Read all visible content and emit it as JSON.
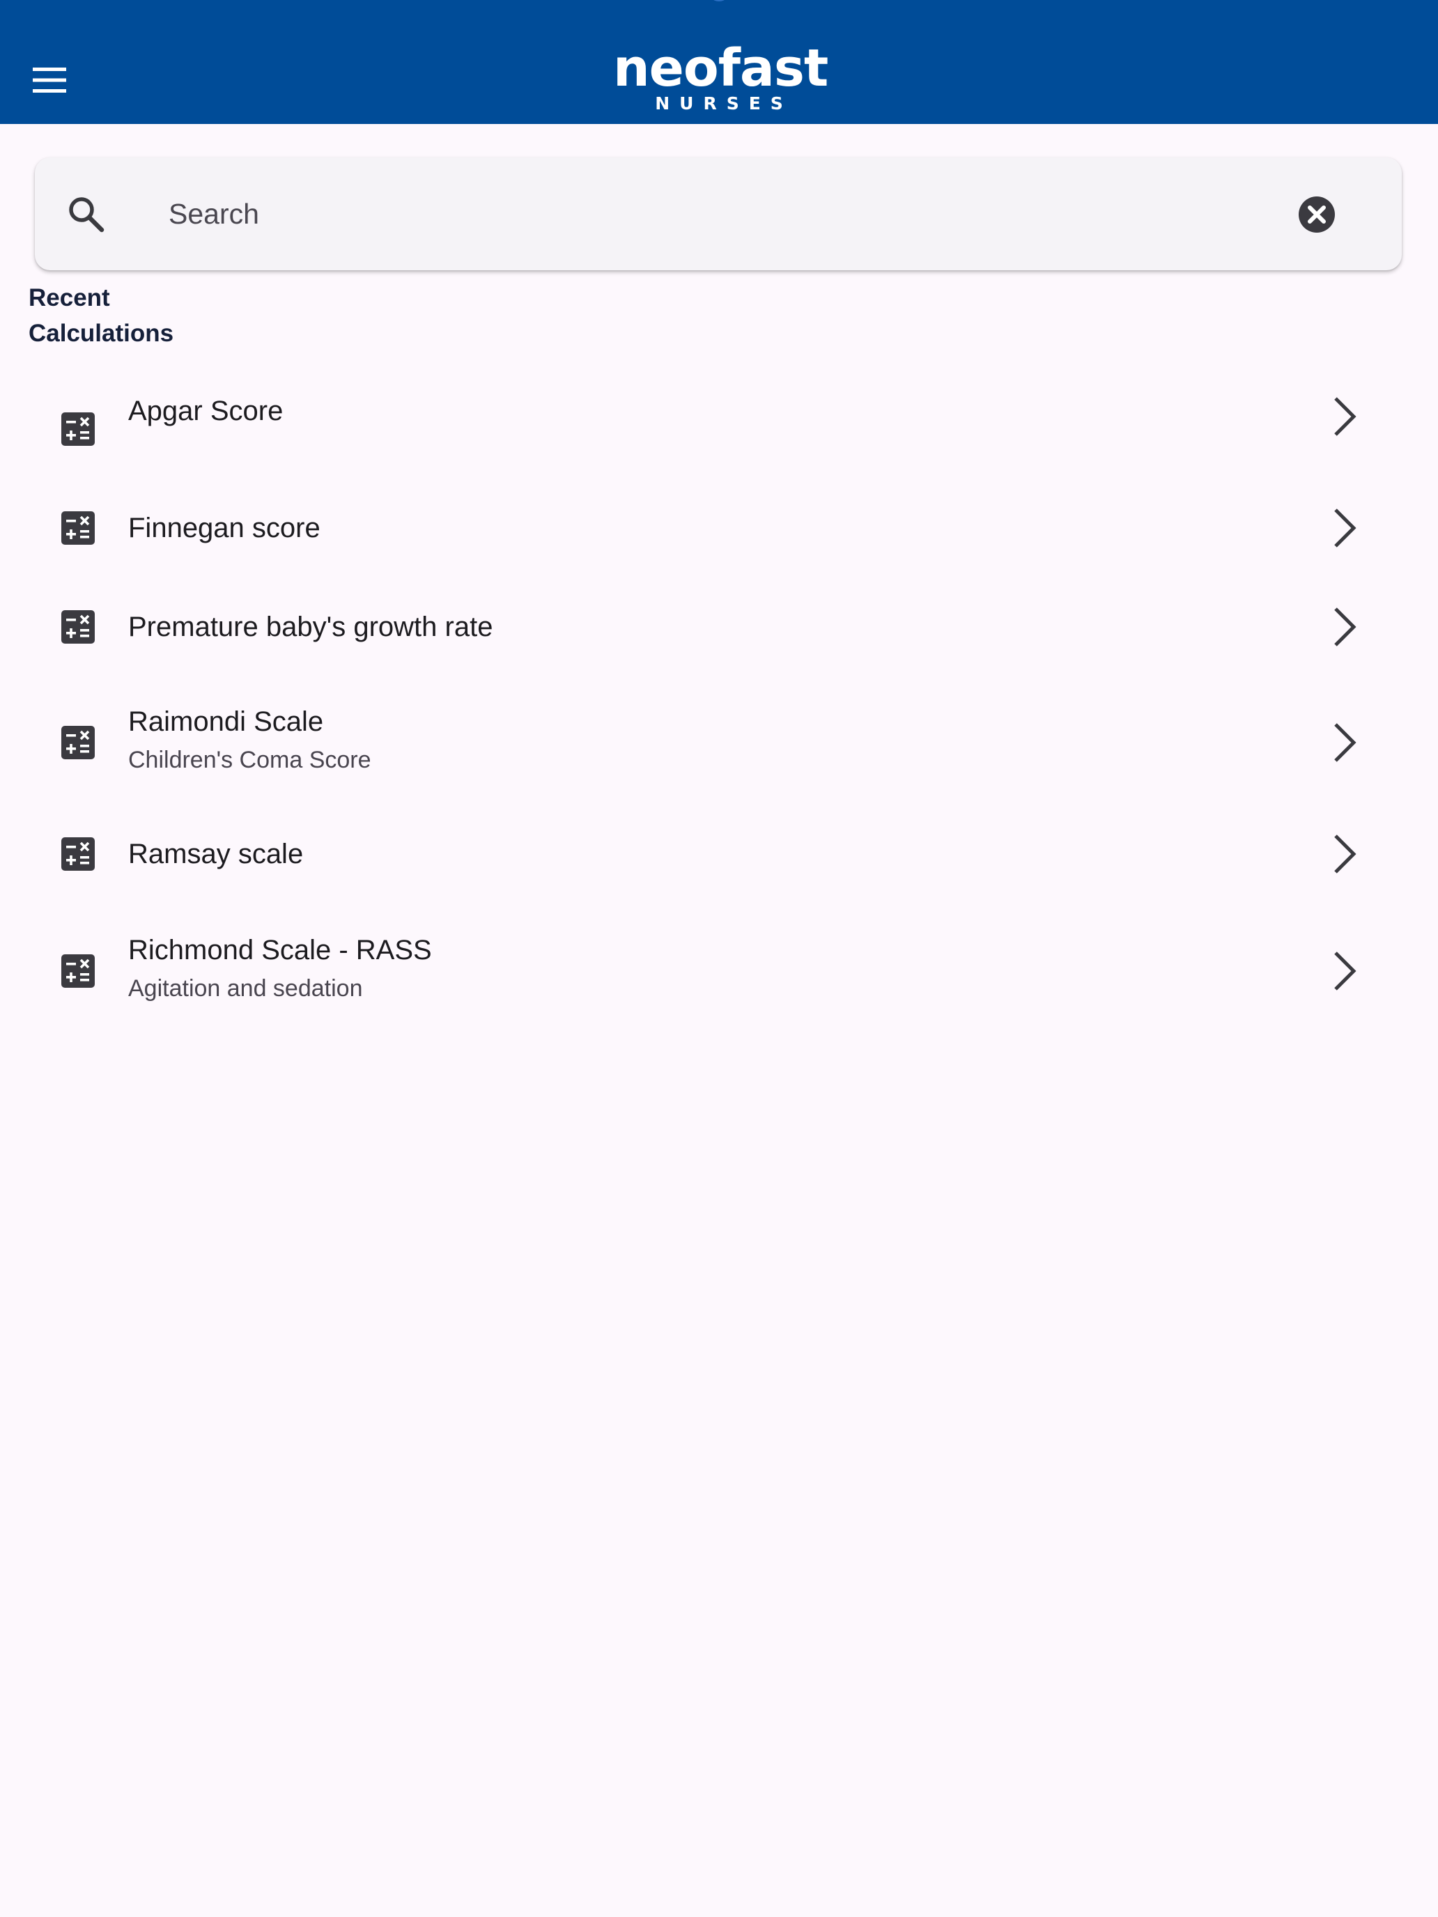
{
  "app": {
    "logo_word": "neofast",
    "logo_sub": "NURSES",
    "brand_color": "#004c98"
  },
  "header": {
    "menu_icon": "hamburger-menu-icon"
  },
  "search": {
    "placeholder": "Search",
    "value": "",
    "icon": "search-icon",
    "clear_icon": "clear-circle-icon"
  },
  "recent": {
    "title": "Recent Calculations",
    "items": [
      {
        "title": "Apgar Score",
        "subtitle": ""
      },
      {
        "title": "Finnegan score",
        "subtitle": ""
      },
      {
        "title": "Premature baby's growth rate",
        "subtitle": ""
      },
      {
        "title": "Raimondi Scale",
        "subtitle": "Children's Coma Score"
      },
      {
        "title": "Ramsay scale",
        "subtitle": ""
      },
      {
        "title": "Richmond Scale - RASS",
        "subtitle": "Agitation and sedation"
      }
    ],
    "item_icon": "calculator-icon",
    "chevron_icon": "chevron-right-icon"
  }
}
